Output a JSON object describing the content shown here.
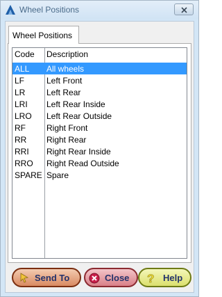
{
  "window": {
    "title": "Wheel Positions",
    "close_glyph": "✕"
  },
  "tab": {
    "label": "Wheel Positions"
  },
  "list": {
    "headers": [
      "Code",
      "Description"
    ],
    "rows": [
      {
        "code": "ALL",
        "description": "All wheels",
        "selected": true
      },
      {
        "code": "LF",
        "description": "Left Front"
      },
      {
        "code": "LR",
        "description": "Left Rear"
      },
      {
        "code": "LRI",
        "description": "Left Rear Inside"
      },
      {
        "code": "LRO",
        "description": "Left Rear Outside"
      },
      {
        "code": "RF",
        "description": "Right Front"
      },
      {
        "code": "RR",
        "description": "Right Rear"
      },
      {
        "code": "RRI",
        "description": "Right Rear Inside"
      },
      {
        "code": "RRO",
        "description": "Right Read Outside"
      },
      {
        "code": "SPARE",
        "description": "Spare"
      }
    ]
  },
  "buttons": {
    "send_to": "Send To",
    "close": "Close",
    "help": "Help"
  },
  "icons": {
    "app": "app-logo-icon",
    "send": "send-arrow-icon",
    "close": "close-x-icon",
    "help": "help-question-icon"
  },
  "colors": {
    "selection": "#3399ff",
    "window_frame": "#d3e6f6"
  }
}
